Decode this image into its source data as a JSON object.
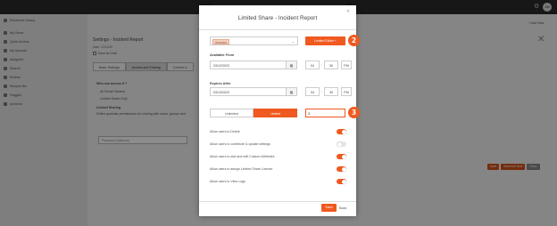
{
  "topbar": {
    "search_text": "Search in Content Library",
    "avatar_initials": "AM"
  },
  "sidebar": {
    "items": [
      {
        "label": "Enhanced Library",
        "icon": "library-icon"
      },
      {
        "label": "My Views",
        "icon": "views-icon"
      },
      {
        "label": "Quick Access",
        "icon": "quick-access-icon"
      },
      {
        "label": "My Uploads",
        "icon": "uploads-icon"
      },
      {
        "label": "Assigned",
        "icon": "assigned-icon"
      },
      {
        "label": "Shared",
        "icon": "shared-icon"
      },
      {
        "label": "Review",
        "icon": "review-icon"
      },
      {
        "label": "Recycle Bin",
        "icon": "recycle-bin-icon"
      },
      {
        "label": "Flagged",
        "icon": "flag-icon"
      },
      {
        "label": "Archived",
        "icon": "archive-icon"
      }
    ]
  },
  "main": {
    "add_new": "+ Add New",
    "title": "Settings - Incident Report",
    "subtitle": "Date: 12/11/20",
    "check_label": "Save as Draft",
    "tabs": [
      "Basic Settings",
      "Access and Sharing",
      "Content A"
    ],
    "who_label": "Who can access it ?",
    "radio_all": "All Portal Viewers",
    "radio_limited": "Limited Share Only",
    "limited_heading": "Limited Sharing",
    "limited_desc": "Define granular permissions for sharing with users, groups and",
    "password_placeholder": "Password (Optional)",
    "buttons": {
      "save": "Save",
      "save_next": "Save And Next",
      "close": "Close"
    }
  },
  "modal": {
    "title": "Limited Share - Incident Report",
    "share_select_value": "Selected",
    "limited_editor_button": "Limited Editor +",
    "badge_one": "2",
    "badge_two": "3",
    "available_from_label": "Available From",
    "available_from_date": "03/12/2023",
    "available_from_hour": "04",
    "available_from_minute": "30",
    "available_from_ampm": "PM",
    "expires_after_label": "Expires After",
    "expires_after_date": "03/13/2023",
    "expires_after_hour": "04",
    "expires_after_minute": "30",
    "expires_after_ampm": "PM",
    "segment_unlimited": "Unlimited",
    "segment_limited": "Limited",
    "limit_value": "3",
    "permissions": [
      {
        "label": "Allow users to Delete",
        "on": true
      },
      {
        "label": "Allow users to contribute & update settings",
        "on": false
      },
      {
        "label": "Allow users to add and edit Custom Attributes",
        "on": true
      },
      {
        "label": "Allow users to assign Limited Share License",
        "on": true
      },
      {
        "label": "Allow users to View Logs",
        "on": true
      }
    ],
    "save": "Save",
    "back": "Back",
    "accent_color": "#f0591f"
  }
}
